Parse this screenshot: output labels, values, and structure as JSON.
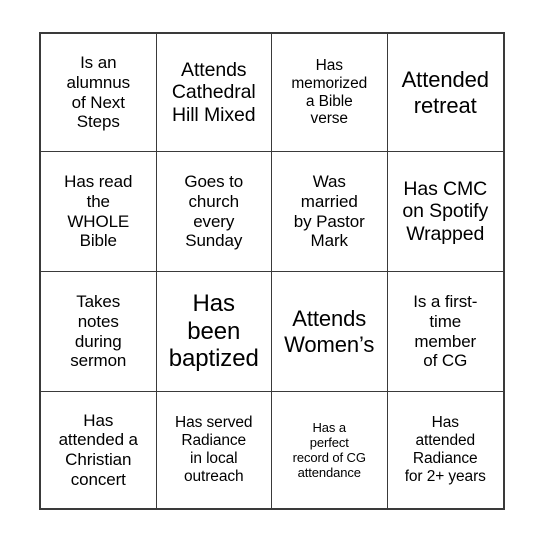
{
  "document": {
    "type": "bingo-card",
    "grid": {
      "columns": 4,
      "rows": 4
    },
    "colors": {
      "background": "#ffffff",
      "border": "#3a3a3a",
      "text": "#000000"
    }
  },
  "cells": [
    {
      "id": "r1c1",
      "text": "Is an\nalumnus\nof Next\nSteps",
      "size": "md"
    },
    {
      "id": "r1c2",
      "text": "Attends\nCathedral\nHill Mixed",
      "size": "lg"
    },
    {
      "id": "r1c3",
      "text": "Has\nmemorized\na Bible\nverse",
      "size": "sm"
    },
    {
      "id": "r1c4",
      "text": "Attended\nretreat",
      "size": "xl"
    },
    {
      "id": "r2c1",
      "text": "Has read\nthe\nWHOLE\nBible",
      "size": "md"
    },
    {
      "id": "r2c2",
      "text": "Goes to\nchurch\nevery\nSunday",
      "size": "md"
    },
    {
      "id": "r2c3",
      "text": "Was\nmarried\nby Pastor\nMark",
      "size": "md"
    },
    {
      "id": "r2c4",
      "text": "Has CMC\non Spotify\nWrapped",
      "size": "lg"
    },
    {
      "id": "r3c1",
      "text": "Takes\nnotes\nduring\nsermon",
      "size": "md"
    },
    {
      "id": "r3c2",
      "text": "Has\nbeen\nbaptized",
      "size": "xxl"
    },
    {
      "id": "r3c3",
      "text": "Attends\nWomen’s",
      "size": "xl"
    },
    {
      "id": "r3c4",
      "text": "Is a first-\ntime\nmember\nof CG",
      "size": "md"
    },
    {
      "id": "r4c1",
      "text": "Has\nattended a\nChristian\nconcert",
      "size": "md"
    },
    {
      "id": "r4c2",
      "text": "Has served\nRadiance\nin local\noutreach",
      "size": "sm"
    },
    {
      "id": "r4c3",
      "text": "Has a\nperfect\nrecord of CG\nattendance",
      "size": "xs"
    },
    {
      "id": "r4c4",
      "text": "Has\nattended\nRadiance\nfor 2+ years",
      "size": "sm"
    }
  ]
}
